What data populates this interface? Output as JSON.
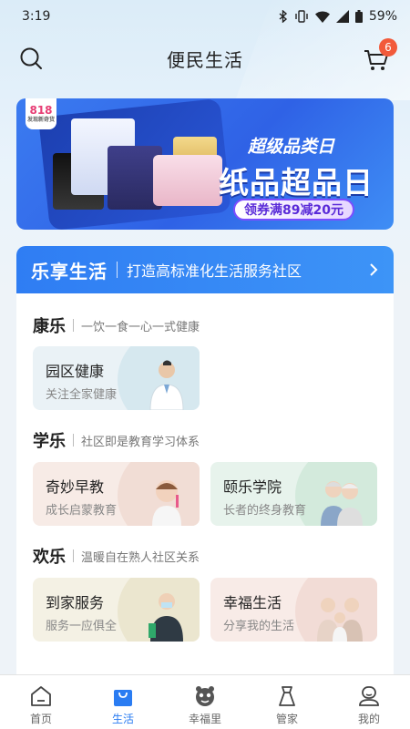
{
  "status_bar": {
    "time": "3:19",
    "battery": "59%"
  },
  "header": {
    "title": "便民生活",
    "cart_count": "6"
  },
  "banner": {
    "logo": "818",
    "logo_sub": "发现新奇货",
    "subtitle": "超级品类日",
    "main_title": "纸品超品日",
    "coupon": "领券满89减20元",
    "accent": "#2f62e6"
  },
  "lexiang": {
    "title": "乐享生活",
    "subtitle": "打造高标准化生活服务社区",
    "sections": [
      {
        "title": "康乐",
        "desc": "一饮一食一心一式健康",
        "tiles": [
          {
            "title": "园区健康",
            "subtitle": "关注全家健康"
          }
        ]
      },
      {
        "title": "学乐",
        "desc": "社区即是教育学习体系",
        "tiles": [
          {
            "title": "奇妙早教",
            "subtitle": "成长启蒙教育"
          },
          {
            "title": "颐乐学院",
            "subtitle": "长者的终身教育"
          }
        ]
      },
      {
        "title": "欢乐",
        "desc": "温暖自在熟人社区关系",
        "tiles": [
          {
            "title": "到家服务",
            "subtitle": "服务一应俱全"
          },
          {
            "title": "幸福生活",
            "subtitle": "分享我的生活"
          }
        ]
      }
    ]
  },
  "tabbar": {
    "items": [
      {
        "label": "首页",
        "icon": "home-icon"
      },
      {
        "label": "生活",
        "icon": "shopping-bag-icon",
        "active": true
      },
      {
        "label": "幸福里",
        "icon": "community-icon"
      },
      {
        "label": "管家",
        "icon": "butler-icon"
      },
      {
        "label": "我的",
        "icon": "profile-icon"
      }
    ]
  },
  "colors": {
    "primary": "#2a7cf2",
    "badge": "#f25a3b"
  }
}
